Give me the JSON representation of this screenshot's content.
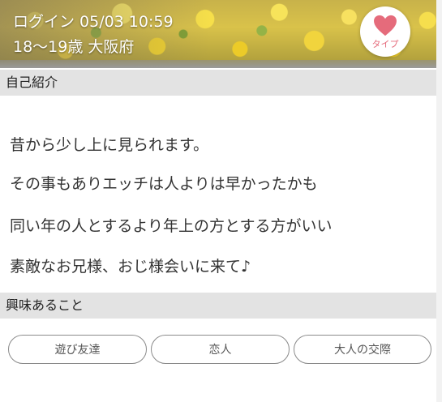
{
  "header": {
    "login_label": "ログイン",
    "login_datetime": "05/03 10:59",
    "age": "18〜19歳",
    "area": "大阪府",
    "type_button_label": "タイプ",
    "heart_color": "#e56b7b"
  },
  "intro_section": {
    "title": "自己紹介",
    "lines": [
      "昔から少し上に見られます。",
      "その事もありエッチは人よりは早かったかも",
      "同い年の人とするより年上の方とする方がいい",
      "素敵なお兄様、おじ様会いに来て♪"
    ]
  },
  "interest_section": {
    "title": "興味あること",
    "tags": [
      "遊び友達",
      "恋人",
      "大人の交際"
    ]
  }
}
